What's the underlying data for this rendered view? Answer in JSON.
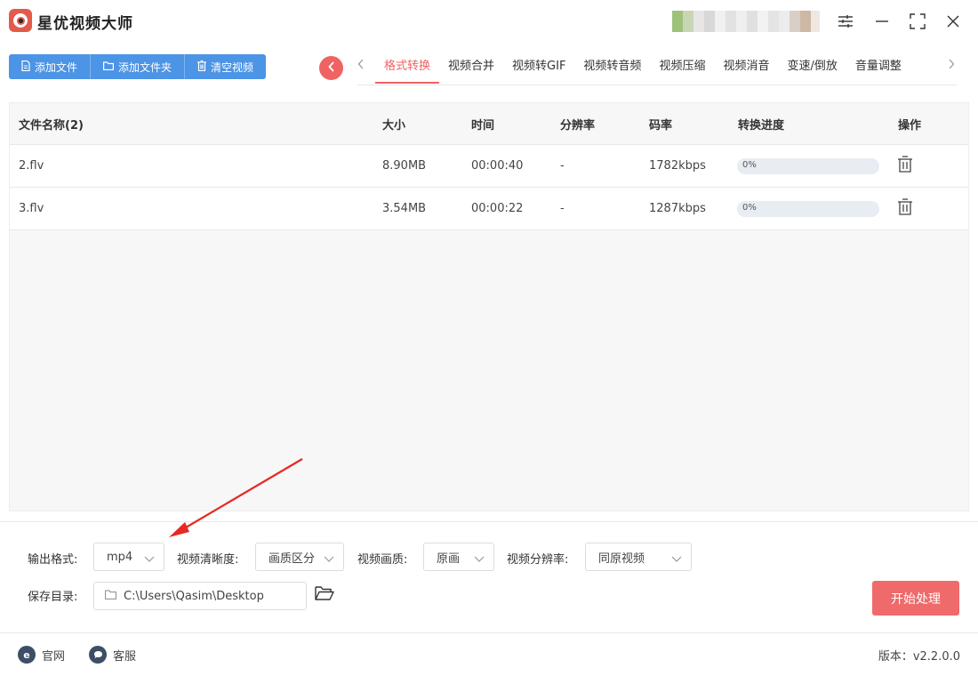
{
  "app": {
    "title": "星优视频大师"
  },
  "toolbar": {
    "add_file": "添加文件",
    "add_folder": "添加文件夹",
    "clear_videos": "清空视频"
  },
  "tabs": [
    {
      "label": "格式转换",
      "active": true
    },
    {
      "label": "视频合并"
    },
    {
      "label": "视频转GIF"
    },
    {
      "label": "视频转音频"
    },
    {
      "label": "视频压缩"
    },
    {
      "label": "视频消音"
    },
    {
      "label": "变速/倒放"
    },
    {
      "label": "音量调整"
    }
  ],
  "table": {
    "headers": {
      "name": "文件名称(2)",
      "size": "大小",
      "time": "时间",
      "resolution": "分辨率",
      "bitrate": "码率",
      "progress": "转换进度",
      "action": "操作"
    },
    "rows": [
      {
        "name": "2.flv",
        "size": "8.90MB",
        "time": "00:00:40",
        "resolution": "-",
        "bitrate": "1782kbps",
        "progress_text": "0%",
        "progress": 0
      },
      {
        "name": "3.flv",
        "size": "3.54MB",
        "time": "00:00:22",
        "resolution": "-",
        "bitrate": "1287kbps",
        "progress_text": "0%",
        "progress": 0
      }
    ]
  },
  "settings": {
    "output_format_label": "输出格式:",
    "output_format_value": "mp4",
    "clarity_label": "视频清晰度:",
    "clarity_value": "画质区分",
    "quality_label": "视频画质:",
    "quality_value": "原画",
    "resolution_label": "视频分辨率:",
    "resolution_value": "同原视频",
    "save_dir_label": "保存目录:",
    "save_dir_value": "C:\\Users\\Qasim\\Desktop",
    "start_button": "开始处理"
  },
  "footer": {
    "website": "官网",
    "support": "客服",
    "version": "版本：v2.2.0.0"
  },
  "colors": {
    "primary_blue": "#4c94e5",
    "accent_red": "#ef6362",
    "start_red": "#ef6a6a"
  },
  "icons": {
    "toolbar": [
      "file-icon",
      "folder-icon",
      "trash-icon"
    ],
    "window": [
      "settings-sliders-icon",
      "minimize-icon",
      "maximize-icon",
      "close-icon"
    ],
    "footer": [
      "ie-browser-icon",
      "chat-bubble-icon"
    ]
  }
}
